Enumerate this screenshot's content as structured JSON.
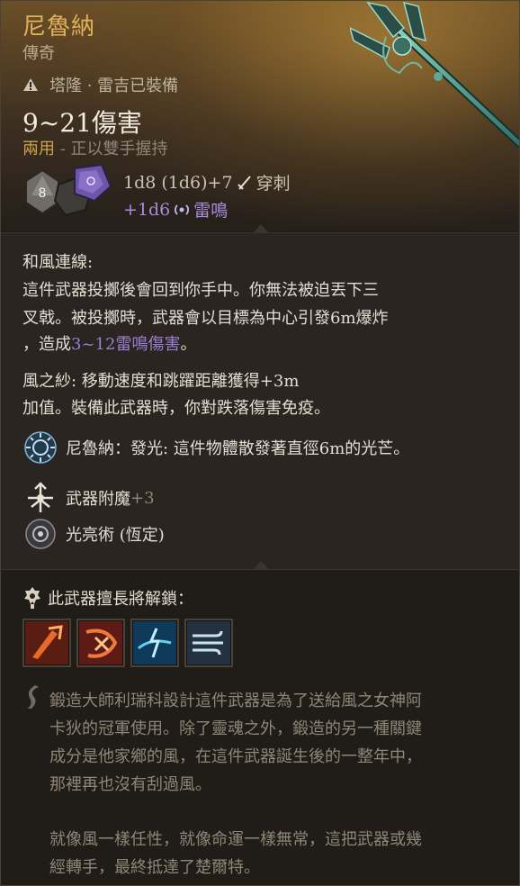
{
  "item": {
    "name": "尼魯納",
    "rarity": "傳奇",
    "requirement": "塔隆 · 雷吉已裝備",
    "damage": "9~21傷害",
    "handedness_tag": "兩用",
    "handedness_note": " - 正以雙手握持",
    "dice_label": "8",
    "damage_line1": "1d8 (1d6)+7",
    "damage_type1": "穿刺",
    "damage_line2": "+1d6",
    "damage_type2": "雷鳴"
  },
  "passive": {
    "title": "和風連線:",
    "line1": "這件武器投擲後會回到你手中。你無法被迫丟下三",
    "line2": "叉戟。被投擲時，武器會以目標為中心引發6m爆炸",
    "line3_a": "，造成",
    "line3_b": "3~12雷鳴傷害",
    "line3_c": "。",
    "wind_line1": "風之紗: 移動速度和跳躍距離獲得+3m",
    "wind_line2": "加值。裝備此武器時，你對跌落傷害免疫。",
    "glow": "尼魯納：發光: 這件物體散發著直徑6m的光芒。",
    "enchant_label": "武器附魔",
    "enchant_value": " +3",
    "spell": "光亮術 (恆定)"
  },
  "mastery": {
    "label": "此武器擅長將解鎖：",
    "skills": [
      "skill-fire-strike-icon",
      "skill-fire-slash-icon",
      "skill-lightning-icon",
      "skill-wind-icon"
    ]
  },
  "lore": {
    "line1": "鍛造大師利瑞科設計這件武器是為了送給風之女神阿",
    "line2": "卡狄的冠軍使用。除了靈魂之外，鍛造的另一種關鍵",
    "line3": "成分是他家鄉的風，在這件武器誕生後的一整年中，",
    "line4": "那裡再也沒有刮過風。",
    "line5": "就像風一樣任性，就像命運一樣無常，這把武器或幾",
    "line6": "經轉手，最終抵達了楚爾特。"
  },
  "colors": {
    "title": "#e0b15a",
    "purple": "#9b7ed2",
    "gray": "#8f8574"
  }
}
